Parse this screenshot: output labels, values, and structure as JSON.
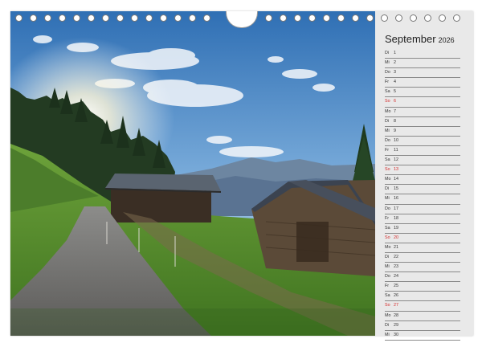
{
  "calendar": {
    "month": "September",
    "year": "2026",
    "days": [
      {
        "abbr": "Di",
        "num": "1",
        "sunday": false
      },
      {
        "abbr": "Mi",
        "num": "2",
        "sunday": false
      },
      {
        "abbr": "Do",
        "num": "3",
        "sunday": false
      },
      {
        "abbr": "Fr",
        "num": "4",
        "sunday": false
      },
      {
        "abbr": "Sa",
        "num": "5",
        "sunday": false
      },
      {
        "abbr": "So",
        "num": "6",
        "sunday": true
      },
      {
        "abbr": "Mo",
        "num": "7",
        "sunday": false
      },
      {
        "abbr": "Di",
        "num": "8",
        "sunday": false
      },
      {
        "abbr": "Mi",
        "num": "9",
        "sunday": false
      },
      {
        "abbr": "Do",
        "num": "10",
        "sunday": false
      },
      {
        "abbr": "Fr",
        "num": "11",
        "sunday": false
      },
      {
        "abbr": "Sa",
        "num": "12",
        "sunday": false
      },
      {
        "abbr": "So",
        "num": "13",
        "sunday": true
      },
      {
        "abbr": "Mo",
        "num": "14",
        "sunday": false
      },
      {
        "abbr": "Di",
        "num": "15",
        "sunday": false
      },
      {
        "abbr": "Mi",
        "num": "16",
        "sunday": false
      },
      {
        "abbr": "Do",
        "num": "17",
        "sunday": false
      },
      {
        "abbr": "Fr",
        "num": "18",
        "sunday": false
      },
      {
        "abbr": "Sa",
        "num": "19",
        "sunday": false
      },
      {
        "abbr": "So",
        "num": "20",
        "sunday": true
      },
      {
        "abbr": "Mo",
        "num": "21",
        "sunday": false
      },
      {
        "abbr": "Di",
        "num": "22",
        "sunday": false
      },
      {
        "abbr": "Mi",
        "num": "23",
        "sunday": false
      },
      {
        "abbr": "Do",
        "num": "24",
        "sunday": false
      },
      {
        "abbr": "Fr",
        "num": "25",
        "sunday": false
      },
      {
        "abbr": "Sa",
        "num": "26",
        "sunday": false
      },
      {
        "abbr": "So",
        "num": "27",
        "sunday": true
      },
      {
        "abbr": "Mo",
        "num": "28",
        "sunday": false
      },
      {
        "abbr": "Di",
        "num": "29",
        "sunday": false
      },
      {
        "abbr": "Mi",
        "num": "30",
        "sunday": false
      }
    ]
  },
  "colors": {
    "sunday": "#d42a2a",
    "panel": "#e9e9e9"
  }
}
